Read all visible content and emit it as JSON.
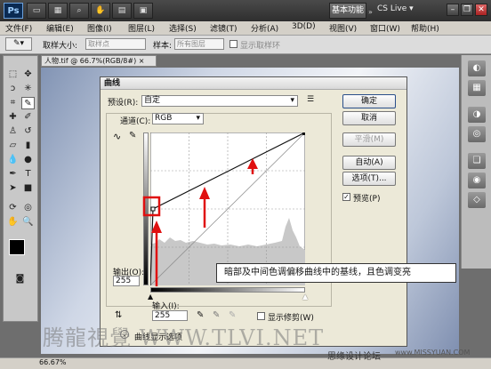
{
  "app": {
    "logo": "Ps",
    "workspace_button": "基本功能",
    "cs_live": "CS Live"
  },
  "menu": [
    "文件(F)",
    "编辑(E)",
    "图像(I)",
    "图层(L)",
    "选择(S)",
    "滤镜(T)",
    "分析(A)",
    "3D(D)",
    "视图(V)",
    "窗口(W)",
    "帮助(H)"
  ],
  "options_bar": {
    "sample_size_label": "取样大小:",
    "sample_size_value": "取样点",
    "sample_label": "样本:",
    "sample_value": "所有图层",
    "show_ring_label": "显示取样环"
  },
  "document": {
    "tab_title": "人物.tif @ 66.7%(RGB/8#)",
    "zoom": "66.67%"
  },
  "dialog": {
    "title": "曲线",
    "preset_label": "预设(R):",
    "preset_value": "自定",
    "channel_label": "通道(C):",
    "channel_value": "RGB",
    "output_label": "输出(O):",
    "output_value": "255",
    "input_label": "输入(I):",
    "input_value": "255",
    "show_clipping_label": "显示修剪(W)",
    "curve_display_label": "曲线显示选项",
    "preview_label": "预览(P)",
    "preview_checked": true,
    "buttons": {
      "ok": "确定",
      "cancel": "取消",
      "smooth": "平滑(M)",
      "auto": "自动(A)",
      "options": "选项(T)..."
    }
  },
  "callout": "暗部及中间色调偏移曲线中的基线，且色调变亮",
  "watermark": "腾龍視覺 WWW.TLVI.NET",
  "credit": "思缘设计论坛",
  "credit_site": "www.MISSYUAN.COM",
  "colors": {
    "annotation_red": "#e01010",
    "dialog_bg": "#ece9d8"
  }
}
